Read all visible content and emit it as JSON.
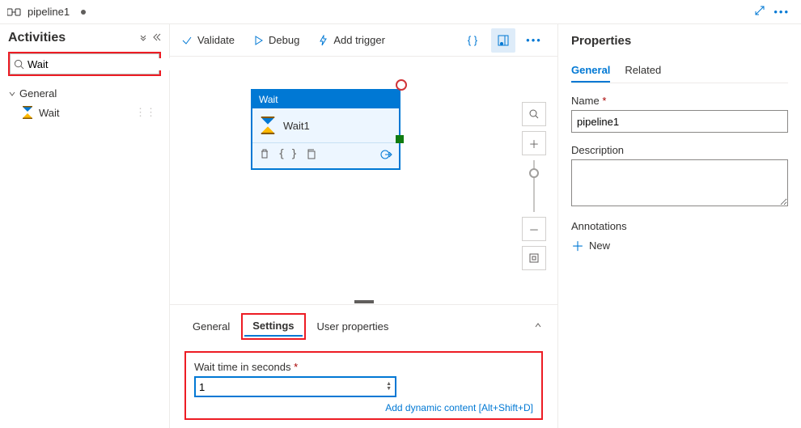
{
  "header": {
    "tab_title": "pipeline1"
  },
  "activities": {
    "title": "Activities",
    "search_value": "Wait",
    "section": "General",
    "item": "Wait"
  },
  "toolbar": {
    "validate": "Validate",
    "debug": "Debug",
    "trigger": "Add trigger"
  },
  "canvas": {
    "node_type": "Wait",
    "node_name": "Wait1"
  },
  "bottom_tabs": {
    "general": "General",
    "settings": "Settings",
    "userprops": "User properties"
  },
  "settings": {
    "wait_label": "Wait time in seconds",
    "wait_value": "1",
    "dynamic": "Add dynamic content [Alt+Shift+D]"
  },
  "properties": {
    "title": "Properties",
    "tab_general": "General",
    "tab_related": "Related",
    "name_label": "Name",
    "name_value": "pipeline1",
    "desc_label": "Description",
    "desc_value": "",
    "ann_label": "Annotations",
    "ann_new": "New"
  }
}
